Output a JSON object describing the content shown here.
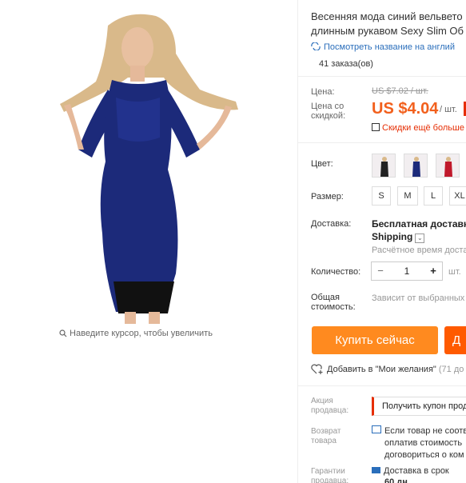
{
  "product": {
    "title_line1": "Весенняя мода синий вельвето",
    "title_line2": "длинным рукавом Sexy Slim Об",
    "translate_link": "Посмотреть название на англий",
    "orders": "41 заказа(ов)"
  },
  "gallery": {
    "zoom_hint": "Наведите курсор, чтобы увеличить"
  },
  "pricing": {
    "price_label": "Цена:",
    "old_price": "US $7.02 / шт.",
    "discount_label_1": "Цена со",
    "discount_label_2": "скидкой:",
    "price": "US $4.04",
    "unit": "/ шт.",
    "more_discounts": "Скидки ещё больше"
  },
  "options": {
    "color_label": "Цвет:",
    "size_label": "Размер:",
    "sizes": [
      "S",
      "M",
      "L",
      "XL"
    ]
  },
  "shipping": {
    "label": "Доставка:",
    "free": "Бесплатная доставка",
    "method": "Shipping",
    "time": "Расчётное время доставки"
  },
  "quantity": {
    "label": "Количество:",
    "minus": "−",
    "value": "1",
    "plus": "+",
    "unit": "шт."
  },
  "total": {
    "label_1": "Общая",
    "label_2": "стоимость:",
    "value": "Зависит от выбранных"
  },
  "actions": {
    "buy_now": "Купить сейчас",
    "add_to_cart": "Д",
    "wishlist": "Добавить в \"Мои желания\"",
    "wishlist_count": "(71 до"
  },
  "seller": {
    "promo_label_1": "Акция",
    "promo_label_2": "продавца:",
    "coupon": "Получить купон прод",
    "return_label_1": "Возврат",
    "return_label_2": "товара",
    "return_line1": "Если товар не соотв",
    "return_line2": "оплатив стоимость",
    "return_line3": "договориться о ком",
    "guarantee_label_1": "Гарантии",
    "guarantee_label_2": "продавца:",
    "guarantee_line1": "Доставка в срок",
    "guarantee_line2": "60 дн"
  },
  "colors": {
    "accent": "#f2601d",
    "buy_button": "#ff8a1f",
    "cart_button": "#ff5a00",
    "link": "#2a6ebb",
    "discount_red": "#e62e04",
    "dress_blue": "#1c2a7a"
  }
}
